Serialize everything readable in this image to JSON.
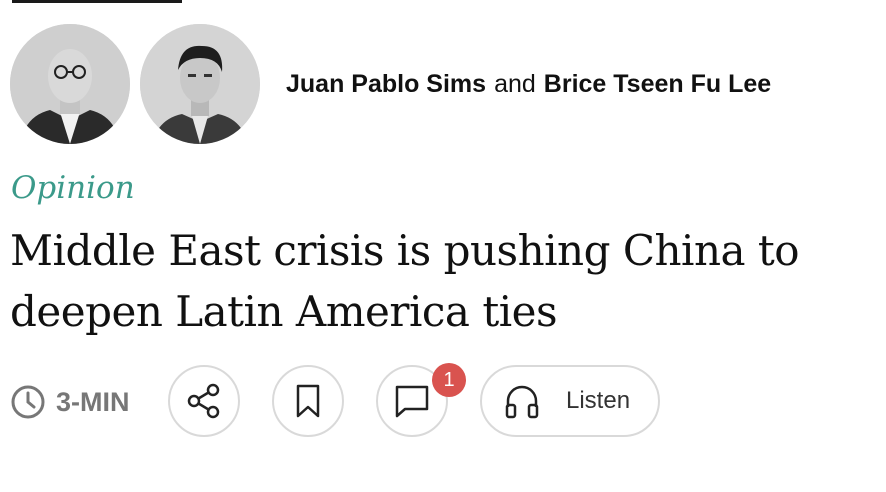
{
  "authors": [
    {
      "name": "Juan Pablo Sims"
    },
    {
      "name": "Brice Tseen Fu Lee"
    }
  ],
  "byline_conjunction": "and",
  "kicker": "Opinion",
  "headline": "Middle East crisis is pushing China to deepen Latin America ties",
  "read_time": "3-MIN",
  "actions": {
    "share_icon": "share-icon",
    "bookmark_icon": "bookmark-icon",
    "comment_icon": "comment-icon",
    "comment_count": "1",
    "listen_label": "Listen",
    "listen_icon": "headphones-icon"
  },
  "colors": {
    "kicker": "#3b9a8a",
    "badge": "#d9534f",
    "button_border": "#d9d9d9",
    "muted_text": "#777777"
  }
}
